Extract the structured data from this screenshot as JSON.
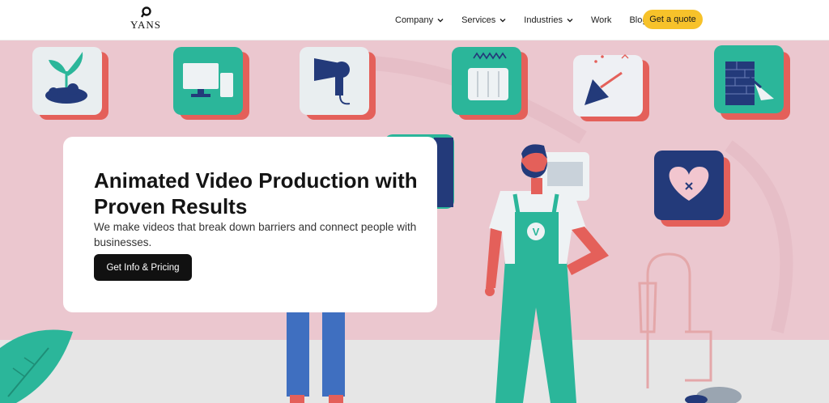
{
  "brand": {
    "name": "YANS"
  },
  "nav": {
    "items": [
      {
        "label": "Company",
        "dropdown": true
      },
      {
        "label": "Services",
        "dropdown": true
      },
      {
        "label": "Industries",
        "dropdown": true
      },
      {
        "label": "Work",
        "dropdown": false
      },
      {
        "label": "Blog",
        "dropdown": false
      }
    ],
    "cta_label": "Get a quote"
  },
  "hero": {
    "title": "Animated Video Production with Proven Results",
    "subtitle": "We make videos that break down barriers and connect people with businesses.",
    "cta_label": "Get Info & Pricing",
    "character_badge": "V"
  },
  "colors": {
    "accent": "#f7c22a",
    "hero_bg": "#ebc7cf",
    "teal": "#2bb69a",
    "coral": "#e4605a",
    "navy": "#233a7a"
  },
  "icons": [
    "plant-icon",
    "computer-icon",
    "hair-dryer-icon",
    "heater-icon",
    "scraper-icon",
    "brick-wall-icon",
    "heart-icon"
  ]
}
